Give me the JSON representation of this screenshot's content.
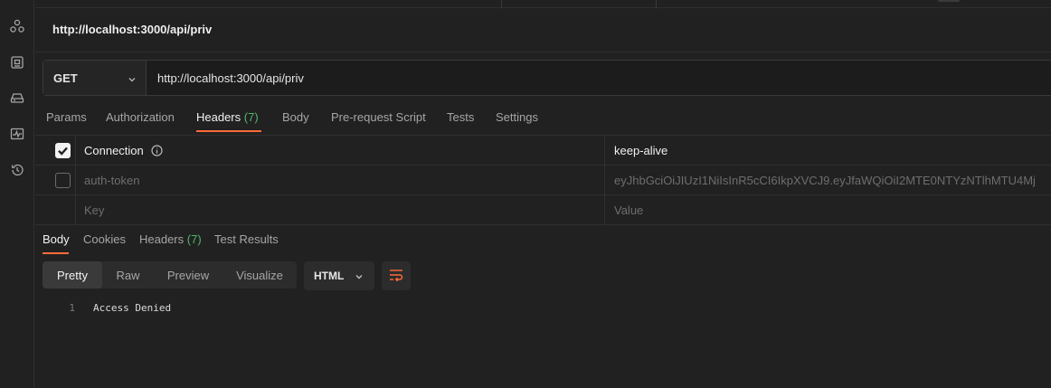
{
  "request": {
    "title": "http://localhost:3000/api/priv",
    "method": "GET",
    "url": "http://localhost:3000/api/priv"
  },
  "request_tabs": [
    {
      "label": "Params"
    },
    {
      "label": "Authorization"
    },
    {
      "label": "Headers",
      "count": "(7)",
      "active": true
    },
    {
      "label": "Body"
    },
    {
      "label": "Pre-request Script"
    },
    {
      "label": "Tests"
    },
    {
      "label": "Settings"
    }
  ],
  "headers": {
    "rows": [
      {
        "key": "Connection",
        "value": "keep-alive",
        "checked": true
      },
      {
        "key": "auth-token",
        "value": "eyJhbGciOiJIUzI1NiIsInR5cCI6IkpXVCJ9.eyJfaWQiOiI2MTE0NTYzNTlhMTU4Mj",
        "checked": false
      }
    ],
    "placeholder_key": "Key",
    "placeholder_value": "Value"
  },
  "response_tabs": [
    {
      "label": "Body",
      "active": true
    },
    {
      "label": "Cookies"
    },
    {
      "label": "Headers",
      "count": "(7)"
    },
    {
      "label": "Test Results"
    }
  ],
  "view_modes": [
    "Pretty",
    "Raw",
    "Preview",
    "Visualize"
  ],
  "active_view": "Pretty",
  "format": "HTML",
  "response_body": {
    "line_number": "1",
    "text": "Access Denied"
  },
  "colors": {
    "accent": "#ff6c37",
    "count": "#4fb86a",
    "background": "#212121"
  },
  "sidebar_icons": [
    "apis-icon",
    "environments-icon",
    "mock-servers-icon",
    "monitors-icon",
    "history-icon"
  ]
}
